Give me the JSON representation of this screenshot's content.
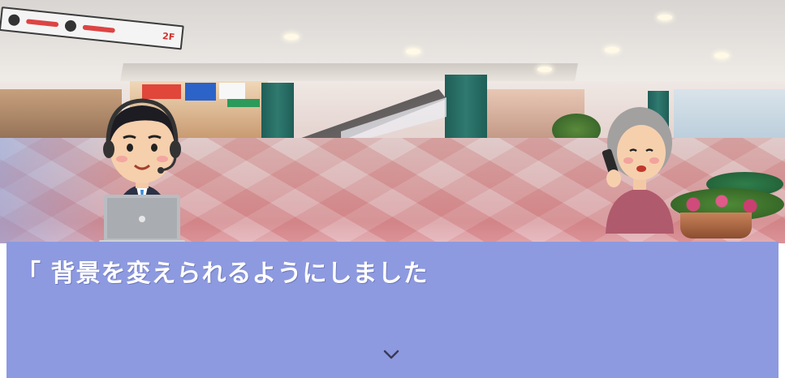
{
  "scene": {
    "background": "shopping-mall-interior",
    "hanging_sign_text": "2F",
    "characters": [
      {
        "role": "operator",
        "description_icon": "call-center-operator-with-headset-and-laptop"
      },
      {
        "role": "caller",
        "description_icon": "elderly-woman-on-phone"
      }
    ]
  },
  "dialogue": {
    "text": "「 背景を変えられるようにしました",
    "next_icon": "chevron-down-icon",
    "window_color": "#8d9ae0",
    "text_color": "#ffffff"
  }
}
